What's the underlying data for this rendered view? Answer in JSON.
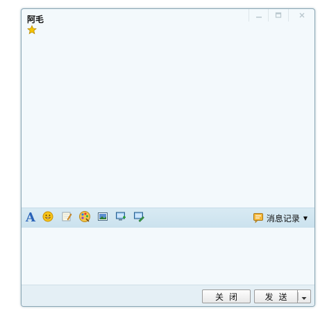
{
  "titlebar": {
    "contact_name": "阿毛",
    "status_icon": "star-icon"
  },
  "window_controls": [
    "minimize-icon",
    "maximize-icon",
    "close-icon"
  ],
  "toolbar": {
    "tools": [
      "font-icon",
      "emoticon-icon",
      "notepad-icon",
      "palette-icon",
      "image-icon",
      "screen-capture-icon",
      "screen-edit-icon"
    ],
    "history_label": "消息记录"
  },
  "footer": {
    "close_label": "关闭",
    "send_label": "发送"
  },
  "colors": {
    "window_bg": "#f3f9fc",
    "toolbar_bg": "#cbe2ee",
    "accent_blue": "#2a63b8",
    "star_yellow": "#f5c400"
  }
}
